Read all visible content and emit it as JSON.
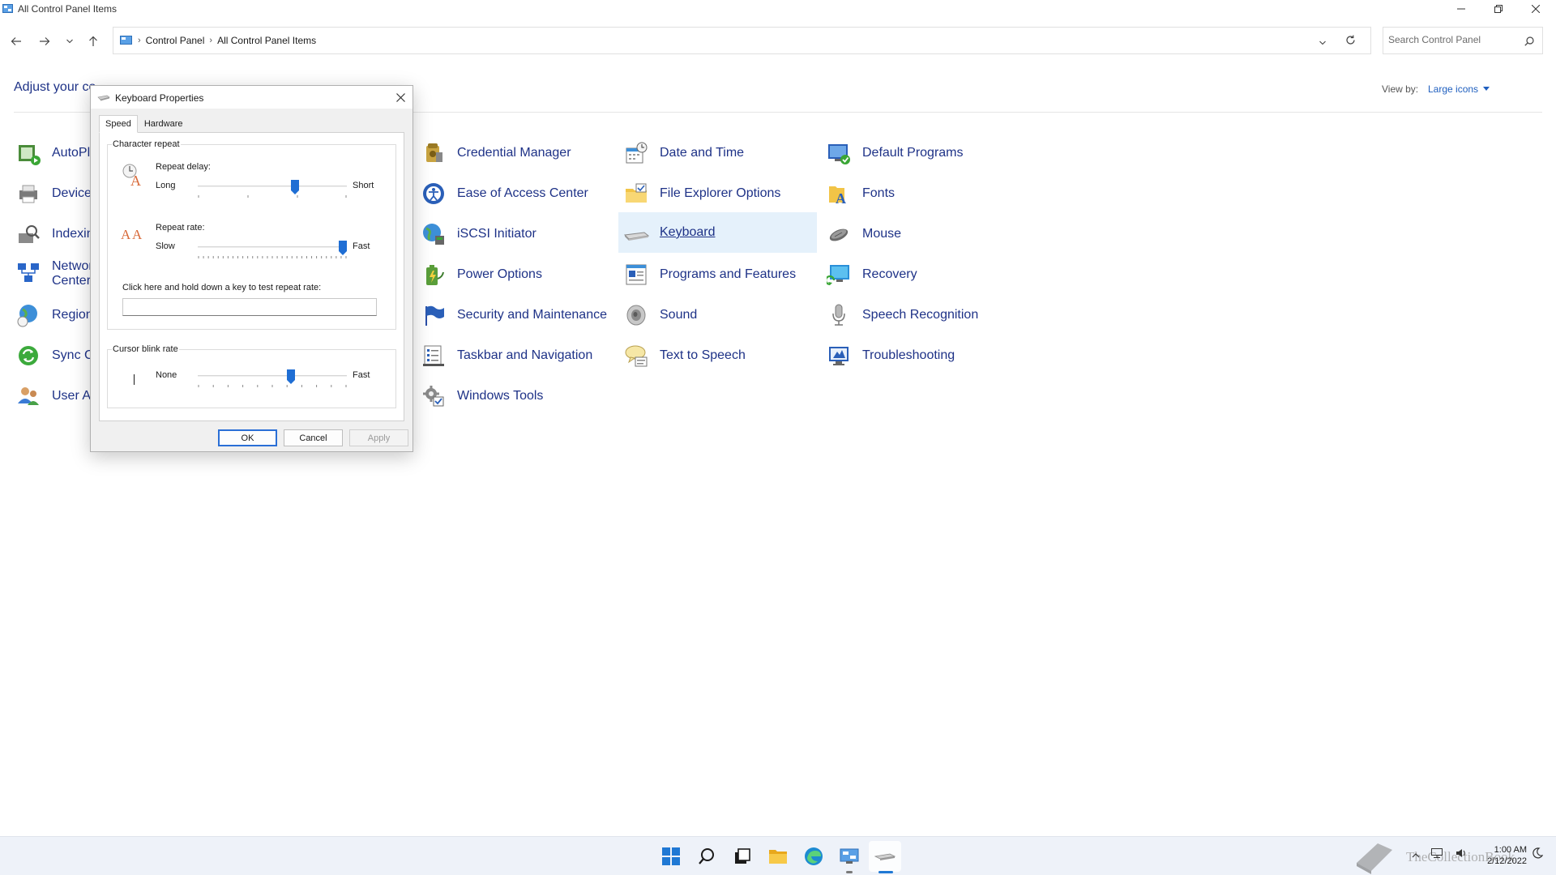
{
  "window": {
    "title": "All Control Panel Items"
  },
  "address": {
    "crumbs": [
      "Control Panel",
      "All Control Panel Items"
    ],
    "search_placeholder": "Search Control Panel"
  },
  "header": {
    "adjust_text": "Adjust your co",
    "view_by_label": "View by:",
    "view_by_value": "Large icons"
  },
  "items": {
    "col0": [
      "AutoPla",
      "Device",
      "Indexin",
      "Networ",
      "Region",
      "Sync Ce",
      "User Ac"
    ],
    "col0_line2": "Center",
    "col1": [
      "Credential Manager",
      "Ease of Access Center",
      "iSCSI Initiator",
      "Power Options",
      "Security and Maintenance",
      "Taskbar and Navigation",
      "Windows Tools"
    ],
    "col2": [
      "Date and Time",
      "File Explorer Options",
      "Keyboard",
      "Programs and Features",
      "Sound",
      "Text to Speech"
    ],
    "col3": [
      "Default Programs",
      "Fonts",
      "Mouse",
      "Recovery",
      "Speech Recognition",
      "Troubleshooting"
    ],
    "selected": "Keyboard"
  },
  "dialog": {
    "title": "Keyboard Properties",
    "tabs": [
      "Speed",
      "Hardware"
    ],
    "active_tab": "Speed",
    "char_repeat": {
      "group_label": "Character repeat",
      "delay_label": "Repeat delay:",
      "delay_min": "Long",
      "delay_max": "Short",
      "delay_value": 0.66,
      "rate_label": "Repeat rate:",
      "rate_min": "Slow",
      "rate_max": "Fast",
      "rate_value": 1.0,
      "test_label": "Click here and hold down a key to test repeat rate:"
    },
    "cursor_blink": {
      "group_label": "Cursor blink rate",
      "min": "None",
      "max": "Fast",
      "value": 0.63
    },
    "buttons": {
      "ok": "OK",
      "cancel": "Cancel",
      "apply": "Apply"
    }
  },
  "taskbar": {
    "time": "1:00 AM",
    "date": "2/12/2022",
    "watermark": "TheCollectionBook"
  },
  "colors": {
    "link": "#1e3287",
    "accent": "#1f6ed4",
    "selected_bg": "#e5f1fb"
  }
}
